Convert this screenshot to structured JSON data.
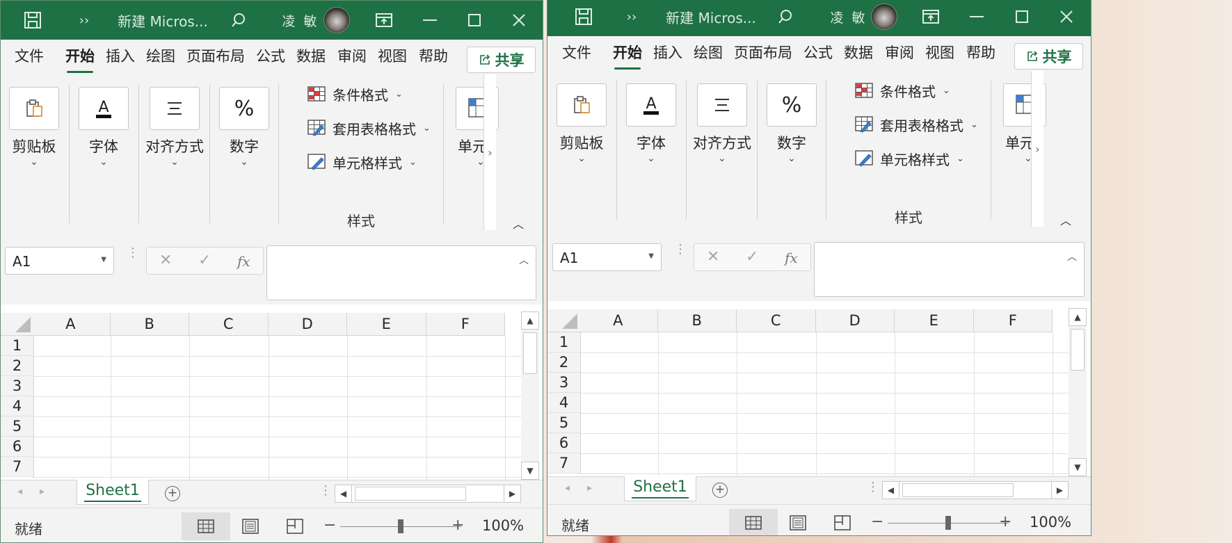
{
  "windows": [
    {
      "title_bar": {
        "title": "新建 Micros...",
        "user": "凌 敏",
        "more_glyph": "››"
      },
      "tabs": [
        "文件",
        "开始",
        "插入",
        "绘图",
        "页面布局",
        "公式",
        "数据",
        "审阅",
        "视图",
        "帮助"
      ],
      "active_tab": "开始",
      "share_label": "共享",
      "ribbon": {
        "groups": [
          {
            "label": "剪贴板",
            "icon": "clipboard-icon"
          },
          {
            "label": "字体",
            "icon": "font-icon"
          },
          {
            "label": "对齐方式",
            "icon": "align-icon"
          },
          {
            "label": "数字",
            "icon": "percent-icon"
          }
        ],
        "styles": {
          "items": [
            "条件格式",
            "套用表格格式",
            "单元格样式"
          ],
          "group_label": "样式"
        },
        "cells_label": "单元"
      },
      "formula_bar": {
        "name_box": "A1",
        "fx_label": "fx",
        "value": ""
      },
      "grid": {
        "columns": [
          "A",
          "B",
          "C",
          "D",
          "E",
          "F"
        ],
        "rows": [
          "1",
          "2",
          "3",
          "4",
          "5",
          "6",
          "7"
        ]
      },
      "sheets": [
        "Sheet1"
      ],
      "status": {
        "text": "就绪",
        "zoom": "100%",
        "zoom_value": 100,
        "active_view": "normal"
      }
    },
    {
      "title_bar": {
        "title": "新建 Micros...",
        "user": "凌 敏",
        "more_glyph": "››"
      },
      "tabs": [
        "文件",
        "开始",
        "插入",
        "绘图",
        "页面布局",
        "公式",
        "数据",
        "审阅",
        "视图",
        "帮助"
      ],
      "active_tab": "开始",
      "share_label": "共享",
      "ribbon": {
        "groups": [
          {
            "label": "剪贴板",
            "icon": "clipboard-icon"
          },
          {
            "label": "字体",
            "icon": "font-icon"
          },
          {
            "label": "对齐方式",
            "icon": "align-icon"
          },
          {
            "label": "数字",
            "icon": "percent-icon"
          }
        ],
        "styles": {
          "items": [
            "条件格式",
            "套用表格格式",
            "单元格样式"
          ],
          "group_label": "样式"
        },
        "cells_label": "单元"
      },
      "formula_bar": {
        "name_box": "A1",
        "fx_label": "fx",
        "value": ""
      },
      "grid": {
        "columns": [
          "A",
          "B",
          "C",
          "D",
          "E",
          "F"
        ],
        "rows": [
          "1",
          "2",
          "3",
          "4",
          "5",
          "6",
          "7"
        ]
      },
      "sheets": [
        "Sheet1"
      ],
      "status": {
        "text": "就绪",
        "zoom": "100%",
        "zoom_value": 100,
        "active_view": "normal"
      }
    }
  ],
  "colors": {
    "title_bar": "#1e7145",
    "accent": "#1e7145",
    "ribbon_bg": "#f3f3f3",
    "grid_line": "#e1e1e1"
  }
}
